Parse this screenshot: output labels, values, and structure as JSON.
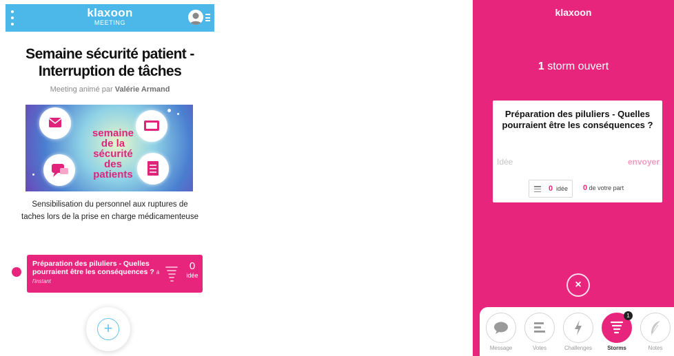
{
  "left": {
    "header": {
      "brand": "klaxoon",
      "subtitle": "MEETING"
    },
    "meeting": {
      "title": "Semaine sécurité patient - Interruption de tâches",
      "animated_by_prefix": "Meeting animé par",
      "animator": "Valérie Armand",
      "banner": {
        "line1": "semaine",
        "line2": "de la sécurité",
        "line3": "des patients"
      },
      "description": "Sensibilisation du personnel aux ruptures de taches lors de la prise en charge médicamenteuse"
    },
    "storm": {
      "question": "Préparation des piluliers - Quelles pourraient être les conséquences ?",
      "time": "à l'instant",
      "count": "0",
      "count_label": "idée"
    },
    "add_label": "+"
  },
  "right": {
    "brand": "klaxoon",
    "open_count": "1",
    "open_label": "storm ouvert",
    "card": {
      "question": "Préparation des piluliers - Quelles pourraient être les conséquences ?",
      "input_placeholder": "Idée",
      "send_label": "envoyer",
      "ideas_value": "0",
      "ideas_label": "idée",
      "yours_value": "0",
      "yours_label": "de votre part"
    },
    "close_label": "×",
    "nav": [
      {
        "label": "Message",
        "icon": "chat-icon"
      },
      {
        "label": "Votes",
        "icon": "votes-icon"
      },
      {
        "label": "Challenges",
        "icon": "lightning-icon"
      },
      {
        "label": "Storms",
        "icon": "tornado-icon",
        "badge": "1",
        "active": true
      },
      {
        "label": "Notes",
        "icon": "feather-icon"
      }
    ]
  },
  "colors": {
    "primary_pink": "#e8257d",
    "header_blue": "#4bb8e9"
  }
}
